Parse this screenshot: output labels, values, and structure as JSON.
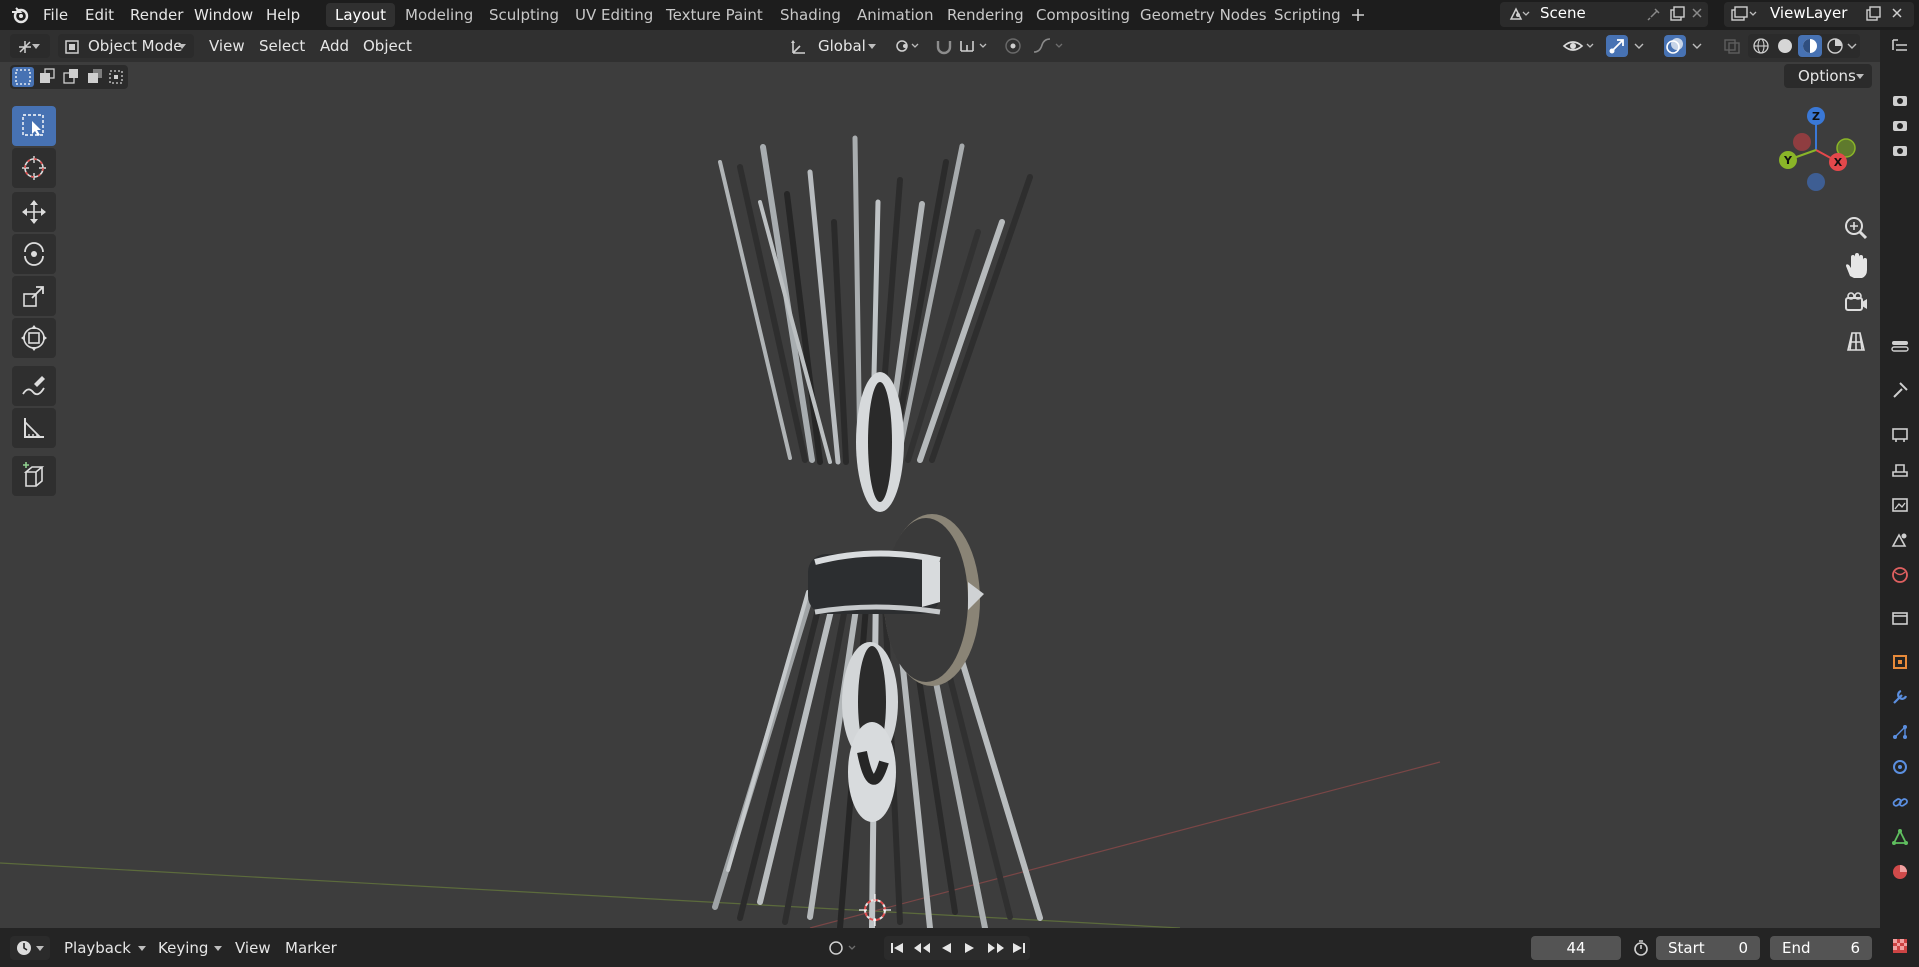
{
  "menu": [
    "File",
    "Edit",
    "Render",
    "Window",
    "Help"
  ],
  "workspaces": [
    {
      "label": "Layout",
      "active": true
    },
    {
      "label": "Modeling",
      "active": false
    },
    {
      "label": "Sculpting",
      "active": false
    },
    {
      "label": "UV Editing",
      "active": false
    },
    {
      "label": "Texture Paint",
      "active": false
    },
    {
      "label": "Shading",
      "active": false
    },
    {
      "label": "Animation",
      "active": false
    },
    {
      "label": "Rendering",
      "active": false
    },
    {
      "label": "Compositing",
      "active": false
    },
    {
      "label": "Geometry Nodes",
      "active": false
    },
    {
      "label": "Scripting",
      "active": false
    }
  ],
  "add_workspace_icon": "plus-icon",
  "scene": {
    "label": "Scene"
  },
  "view_layer": {
    "label": "ViewLayer"
  },
  "header": {
    "mode": "Object Mode",
    "view": "View",
    "select": "Select",
    "add": "Add",
    "object": "Object",
    "transform_orientation": "Global",
    "options": "Options"
  },
  "gizmo": {
    "z": "Z",
    "y": "Y",
    "x": "X"
  },
  "timeline": {
    "playback": "Playback",
    "keying": "Keying",
    "view": "View",
    "marker": "Marker",
    "current_frame": "44",
    "start_label": "Start",
    "start_value": "0",
    "end_label": "End",
    "end_value": "6"
  },
  "colors": {
    "accent": "#4772b3",
    "axis_x": "#e4484b",
    "axis_y": "#8ab528",
    "axis_z": "#3a78d6"
  }
}
